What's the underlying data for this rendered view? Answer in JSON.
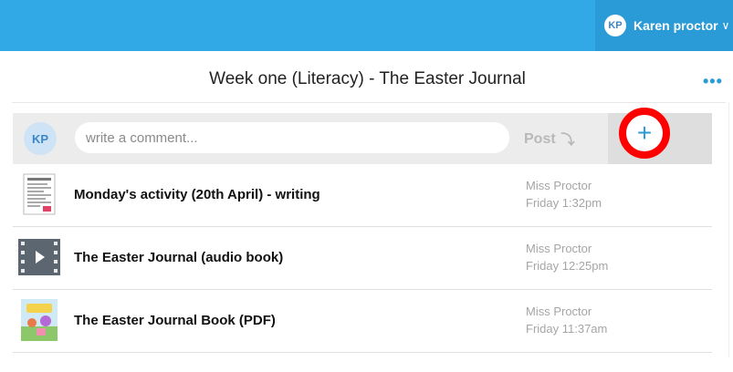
{
  "header": {
    "user_initials": "KP",
    "user_name": "Karen proctor"
  },
  "page": {
    "title": "Week one (Literacy) - The Easter Journal",
    "more_label": "•••"
  },
  "comment_bar": {
    "avatar_initials": "KP",
    "placeholder": "write a comment...",
    "post_label": "Post",
    "add_label": "+"
  },
  "items": [
    {
      "title": "Monday's activity (20th April) - writing",
      "author": "Miss Proctor",
      "time": "Friday 1:32pm",
      "thumb": "document-thumbnail"
    },
    {
      "title": "The Easter Journal (audio book)",
      "author": "Miss Proctor",
      "time": "Friday 12:25pm",
      "thumb": "video-thumbnail"
    },
    {
      "title": "The Easter Journal Book (PDF)",
      "author": "Miss Proctor",
      "time": "Friday 11:37am",
      "thumb": "book-cover-thumbnail"
    }
  ],
  "colors": {
    "topbar": "#30a9e6",
    "accent": "#2a9bd6",
    "highlight_ring": "#ff0000"
  }
}
